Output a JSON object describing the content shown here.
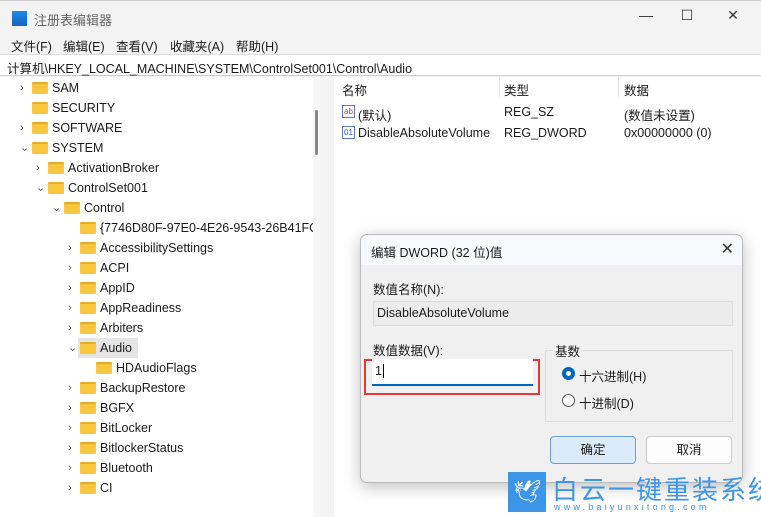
{
  "window": {
    "title": "注册表编辑器",
    "minimize": "—",
    "maximize": "☐",
    "close": "✕"
  },
  "menu": [
    "文件(F)",
    "编辑(E)",
    "查看(V)",
    "收藏夹(A)",
    "帮助(H)"
  ],
  "address": "计算机\\HKEY_LOCAL_MACHINE\\SYSTEM\\ControlSet001\\Control\\Audio",
  "tree": [
    {
      "label": "SAM",
      "level": 0,
      "arrow": "›"
    },
    {
      "label": "SECURITY",
      "level": 0,
      "arrow": ""
    },
    {
      "label": "SOFTWARE",
      "level": 0,
      "arrow": "›"
    },
    {
      "label": "SYSTEM",
      "level": 0,
      "arrow": "⌄"
    },
    {
      "label": "ActivationBroker",
      "level": 1,
      "arrow": "›"
    },
    {
      "label": "ControlSet001",
      "level": 1,
      "arrow": "⌄"
    },
    {
      "label": "Control",
      "level": 2,
      "arrow": "⌄"
    },
    {
      "label": "{7746D80F-97E0-4E26-9543-26B41FC",
      "level": 3,
      "arrow": ""
    },
    {
      "label": "AccessibilitySettings",
      "level": 3,
      "arrow": "›"
    },
    {
      "label": "ACPI",
      "level": 3,
      "arrow": "›"
    },
    {
      "label": "AppID",
      "level": 3,
      "arrow": "›"
    },
    {
      "label": "AppReadiness",
      "level": 3,
      "arrow": "›"
    },
    {
      "label": "Arbiters",
      "level": 3,
      "arrow": "›"
    },
    {
      "label": "Audio",
      "level": 3,
      "arrow": "⌄",
      "selected": true
    },
    {
      "label": "HDAudioFlags",
      "level": 4,
      "arrow": ""
    },
    {
      "label": "BackupRestore",
      "level": 3,
      "arrow": "›"
    },
    {
      "label": "BGFX",
      "level": 3,
      "arrow": "›"
    },
    {
      "label": "BitLocker",
      "level": 3,
      "arrow": "›"
    },
    {
      "label": "BitlockerStatus",
      "level": 3,
      "arrow": "›"
    },
    {
      "label": "Bluetooth",
      "level": 3,
      "arrow": "›"
    },
    {
      "label": "CI",
      "level": 3,
      "arrow": "›"
    }
  ],
  "list": {
    "headers": [
      "名称",
      "类型",
      "数据"
    ],
    "rows": [
      {
        "name": "(默认)",
        "type": "REG_SZ",
        "data": "(数值未设置)",
        "icon": "ab"
      },
      {
        "name": "DisableAbsoluteVolume",
        "type": "REG_DWORD",
        "data": "0x00000000 (0)",
        "icon": "01"
      }
    ]
  },
  "dialog": {
    "title": "编辑 DWORD (32 位)值",
    "close": "✕",
    "name_label": "数值名称(N):",
    "name_value": "DisableAbsoluteVolume",
    "data_label": "数值数据(V):",
    "data_value": "1",
    "base_label": "基数",
    "radio_hex": "十六进制(H)",
    "radio_dec": "十进制(D)",
    "selected_base": "hex",
    "ok": "确定",
    "cancel": "取消"
  },
  "watermark": {
    "text": "白云一键重装系统",
    "url": "www.baiyunxitong.com"
  }
}
